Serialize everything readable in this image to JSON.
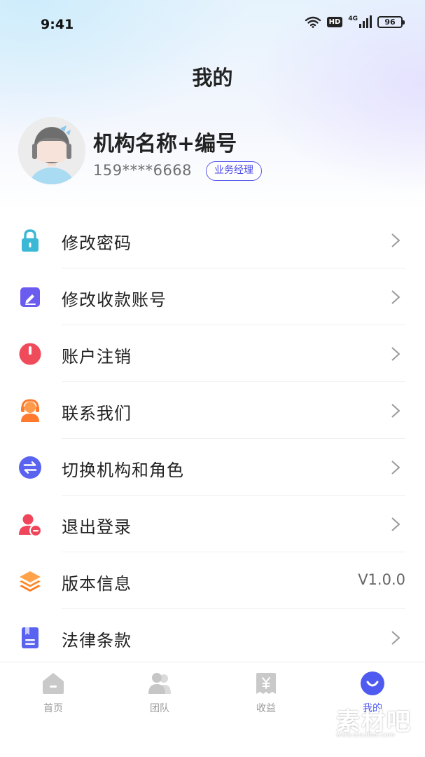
{
  "status_bar": {
    "time": "9:41",
    "network_label": "4G",
    "hd_label": "HD",
    "battery": "96",
    "icons": [
      "wifi-icon",
      "hd-icon",
      "signal-icon",
      "battery-icon"
    ]
  },
  "header": {
    "title": "我的"
  },
  "profile": {
    "name": "机构名称+编号",
    "phone": "159****6668",
    "role": "业务经理"
  },
  "menu": {
    "items": [
      {
        "label": "修改密码",
        "icon": "lock-icon",
        "trailing": "chevron"
      },
      {
        "label": "修改收款账号",
        "icon": "edit-icon",
        "trailing": "chevron"
      },
      {
        "label": "账户注销",
        "icon": "power-icon",
        "trailing": "chevron"
      },
      {
        "label": "联系我们",
        "icon": "headset-icon",
        "trailing": "chevron"
      },
      {
        "label": "切换机构和角色",
        "icon": "switch-icon",
        "trailing": "chevron"
      },
      {
        "label": "退出登录",
        "icon": "user-logout-icon",
        "trailing": "chevron"
      },
      {
        "label": "版本信息",
        "icon": "layers-icon",
        "trailing": "text",
        "value": "V1.0.0"
      },
      {
        "label": "法律条款",
        "icon": "book-icon",
        "trailing": "chevron"
      }
    ]
  },
  "tab_bar": {
    "tabs": [
      {
        "label": "首页",
        "icon": "home-icon",
        "active": false
      },
      {
        "label": "团队",
        "icon": "team-icon",
        "active": false
      },
      {
        "label": "收益",
        "icon": "earnings-icon",
        "active": false
      },
      {
        "label": "我的",
        "icon": "profile-smile-icon",
        "active": true
      }
    ]
  },
  "watermark": {
    "text": "素材吧",
    "sub": "www.sucaibar.com"
  },
  "colors": {
    "accent": "#4f5bf0",
    "lock": "#3bb8d6",
    "edit": "#6b5cf0",
    "power": "#ef4b5b",
    "headset": "#ff7a2e",
    "switch": "#5a63f0",
    "logout": "#f0465c",
    "layers": "#ff8a2a",
    "book": "#5a63f0"
  }
}
